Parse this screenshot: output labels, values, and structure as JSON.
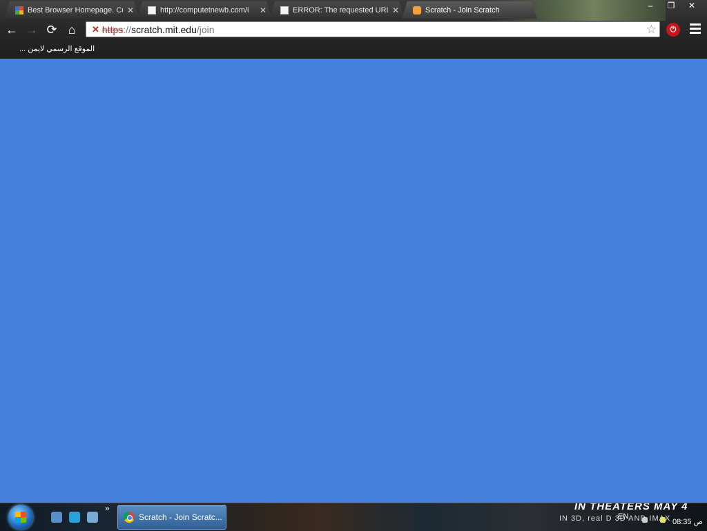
{
  "tabs": [
    {
      "title": "Best Browser Homepage. Cu",
      "favicon": "multicolor-grid-icon",
      "active": false
    },
    {
      "title": "http://computetnewb.com/i",
      "favicon": "page-icon",
      "active": false
    },
    {
      "title": "ERROR: The requested URL",
      "favicon": "page-icon",
      "active": false
    },
    {
      "title": "Scratch - Join Scratch",
      "favicon": "scratch-cat-icon",
      "active": true
    }
  ],
  "tab_close_glyph": "✕",
  "window_controls": {
    "minimize": "–",
    "maximize": "❐",
    "close": "✕"
  },
  "toolbar": {
    "back": "←",
    "forward": "→",
    "reload": "⟳",
    "home": "⌂",
    "bookmark_star": "☆",
    "extension_label": "⏻"
  },
  "omnibox": {
    "warning_glyph": "✕",
    "scheme": "https",
    "separator": "://",
    "host": "scratch.mit.edu",
    "path": "/join"
  },
  "bookmarks_bar": {
    "item": "الموقع الرسمي لايمن ..."
  },
  "colors": {
    "page_background": "#4480dc",
    "https_warning": "#c0201c"
  },
  "taskbar": {
    "quick_launch_more": "»",
    "active_task": "Scratch - Join Scratc...",
    "promo_line1": "IN THEATERS MAY 4",
    "promo_line2": "IN 3D, real D 3D AND IMAX",
    "language": "EN",
    "clock": "08:35 ص"
  }
}
